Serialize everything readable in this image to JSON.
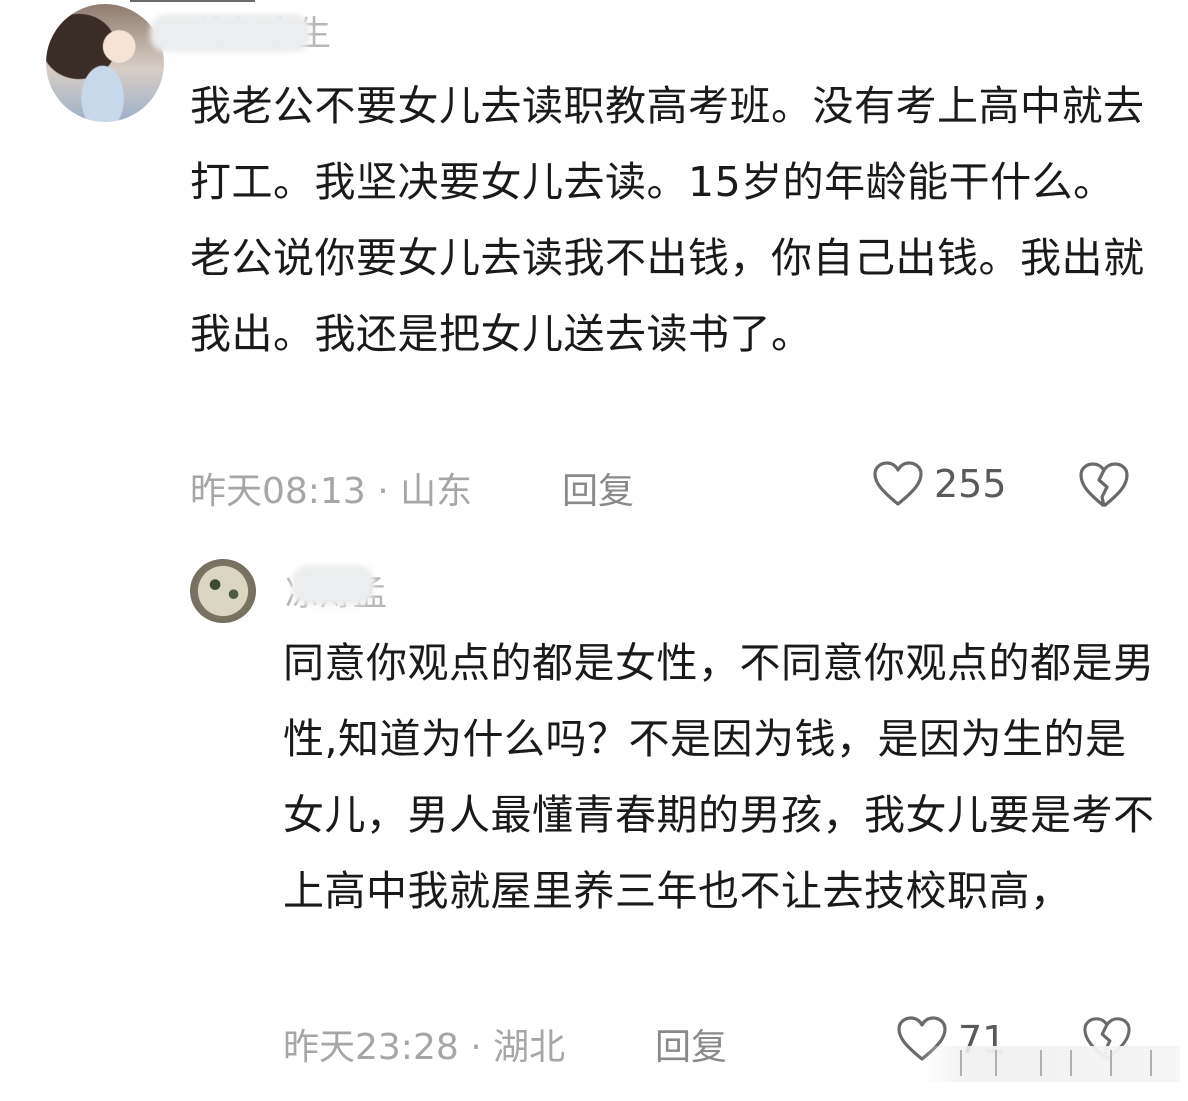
{
  "comment": {
    "username": "简静余生",
    "text": "我老公不要女儿去读职教高考班。没有考上高中就去打工。我坚决要女儿去读。15岁的年龄能干什么。老公说你要女儿去读我不出钱，你自己出钱。我出就我出。我还是把女儿送去读书了。",
    "meta": "昨天08:13 · 山东",
    "reply_label": "回复",
    "like_count": "255"
  },
  "reply": {
    "username": "凉薄孟",
    "text": "同意你观点的都是女性，不同意你观点的都是男性,知道为什么吗？不是因为钱，是因为生的是女儿，男人最懂青春期的男孩，我女儿要是考不上高中我就屋里养三年也不让去技校职高，",
    "meta": "昨天23:28 · 湖北",
    "reply_label": "回复",
    "like_count": "71"
  },
  "icons": {
    "like": "heart-outline-icon",
    "dislike": "broken-heart-outline-icon"
  },
  "colors": {
    "text": "#1a1a1a",
    "meta": "#a6a6a6",
    "username": "#b7b7b7"
  }
}
